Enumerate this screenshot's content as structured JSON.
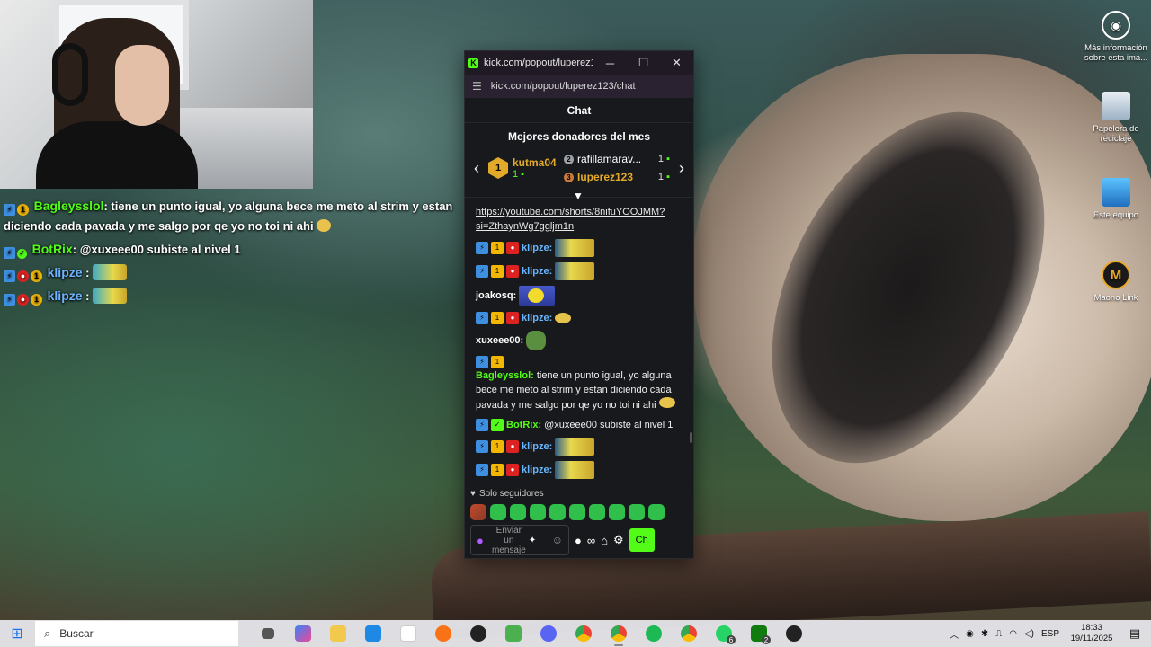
{
  "popup": {
    "title": "kick.com/popout/luperez12...",
    "url": "kick.com/popout/luperez123/chat",
    "chat_header": "Chat",
    "donors_title": "Mejores donadores del mes",
    "first_donor": {
      "rank": "1",
      "name": "kutma04",
      "count": "1"
    },
    "donors": [
      {
        "rank": "2",
        "name": "rafillamarav...",
        "count": "1"
      },
      {
        "rank": "3",
        "name": "luperez123",
        "count": "1"
      }
    ],
    "link_line1": "https://youtube.com/shorts/8nifuYOOJMM?",
    "link_line2": "si=ZthaynWg7ggljm1n",
    "users": {
      "klipze": "klipze:",
      "joakosq": "joakosq:",
      "xuxeee00": "xuxeee00:",
      "bagleysslol": "Bagleysslol:",
      "botrix": "BotRix:"
    },
    "msg_bagley": "tiene un punto igual, yo alguna bece me meto al strim y estan diciendo cada pavada y me salgo por qe yo no toi ni ahi",
    "msg_botrix": "@xuxeee00 subiste al nivel 1",
    "follower_mode": "Solo seguidores",
    "input_placeholder": "Enviar un mensaje",
    "send_label": "Ch"
  },
  "overlay": {
    "bagley_user": "Bagleysslol",
    "bagley_text": ": tiene un punto igual, yo alguna bece me meto al strim y estan diciendo cada pavada y me salgo por qe yo no toi ni ahi",
    "botrix_user": "BotRix",
    "botrix_text": ": @xuxeee00 subiste al nivel 1",
    "klipze_user": "klipze",
    "klipze_sep": ":"
  },
  "desktop": {
    "info_label": "Más información sobre esta ima...",
    "bin_label": "Papelera de reciclaje",
    "pc_label": "Este equipo",
    "maono_label": "Maono Link"
  },
  "taskbar": {
    "search_placeholder": "Buscar",
    "whatsapp_badge": "6",
    "xbox_badge": "2",
    "lang": "ESP",
    "time": "18:33",
    "date": "19/11/2025"
  },
  "colors": {
    "kick_green": "#53fc18",
    "popup_bg": "#18191c",
    "username_blue": "#68b5ff"
  }
}
